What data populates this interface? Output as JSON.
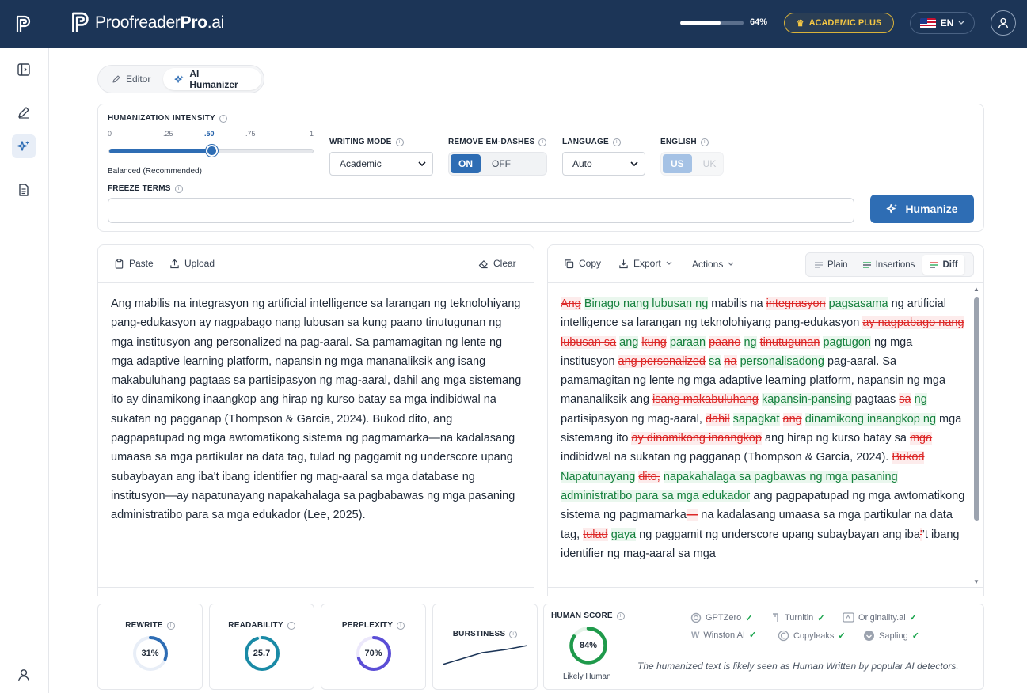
{
  "header": {
    "brand_name_light": "Proofreader",
    "brand_name_bold": "Pro",
    "brand_suffix": ".ai",
    "usage_percent_label": "64%",
    "usage_fraction": 0.64,
    "plan_label": "ACADEMIC PLUS",
    "language_label": "EN"
  },
  "mode_tabs": [
    {
      "label": "Editor"
    },
    {
      "label": "AI Humanizer"
    }
  ],
  "settings": {
    "intensity": {
      "label": "HUMANIZATION INTENSITY",
      "ticks": [
        "0",
        ".25",
        ".50",
        ".75",
        "1"
      ],
      "value": 0.5,
      "caption": "Balanced (Recommended)"
    },
    "writing_mode": {
      "label": "WRITING MODE",
      "value": "Academic"
    },
    "em_dashes": {
      "label": "REMOVE EM-DASHES",
      "on": "ON",
      "off": "OFF"
    },
    "language": {
      "label": "LANGUAGE",
      "value": "Auto"
    },
    "english": {
      "label": "ENGLISH",
      "us": "US",
      "uk": "UK"
    },
    "freeze_terms": {
      "label": "FREEZE TERMS",
      "value": ""
    },
    "humanize_label": "Humanize"
  },
  "input_pane": {
    "paste_label": "Paste",
    "upload_label": "Upload",
    "clear_label": "Clear",
    "text": "Ang mabilis na integrasyon ng artificial intelligence sa larangan ng teknolohiyang pang-edukasyon ay nagpabago nang lubusan sa kung paano tinutugunan ng mga institusyon ang personalized na pag-aaral. Sa pamamagitan ng lente ng mga adaptive learning platform, napansin ng mga mananaliksik ang isang makabuluhang pagtaas sa partisipasyon ng mag-aaral, dahil ang mga sistemang ito ay dinamikong inaangkop ang hirap ng kurso batay sa mga indibidwal na sukatan ng pagganap (Thompson & Garcia, 2024). Bukod dito, ang pagpapatupad ng mga awtomatikong sistema ng pagmamarka—na kadalasang umaasa sa mga partikular na data tag, tulad ng paggamit ng underscore upang subaybayan ang iba't ibang identifier ng mag-aaral sa mga database ng institusyon—ay napatunayang napakahalaga sa pagbabawas ng mga pasaning administratibo para sa mga edukador (Lee, 2025)."
  },
  "output_pane": {
    "copy_label": "Copy",
    "export_label": "Export",
    "actions_label": "Actions",
    "views": [
      {
        "label": "Plain"
      },
      {
        "label": "Insertions"
      },
      {
        "label": "Diff"
      }
    ],
    "segments": [
      {
        "t": "del",
        "s": "Ang"
      },
      {
        "t": "txt",
        "s": " "
      },
      {
        "t": "ins",
        "s": "Binago nang lubusan ng"
      },
      {
        "t": "txt",
        "s": " mabilis na "
      },
      {
        "t": "del",
        "s": "integrasyon"
      },
      {
        "t": "txt",
        "s": " "
      },
      {
        "t": "ins",
        "s": "pagsasama"
      },
      {
        "t": "txt",
        "s": " ng artificial intelligence sa larangan ng teknolohiyang pang-edukasyon "
      },
      {
        "t": "del",
        "s": "ay nagpabago nang lubusan sa"
      },
      {
        "t": "txt",
        "s": " "
      },
      {
        "t": "ins",
        "s": "ang"
      },
      {
        "t": "txt",
        "s": " "
      },
      {
        "t": "del",
        "s": "kung"
      },
      {
        "t": "txt",
        "s": " "
      },
      {
        "t": "ins",
        "s": "paraan"
      },
      {
        "t": "txt",
        "s": " "
      },
      {
        "t": "del",
        "s": "paano"
      },
      {
        "t": "txt",
        "s": " "
      },
      {
        "t": "ins",
        "s": "ng"
      },
      {
        "t": "txt",
        "s": " "
      },
      {
        "t": "del",
        "s": "tinutugunan"
      },
      {
        "t": "txt",
        "s": " "
      },
      {
        "t": "ins",
        "s": "pagtugon"
      },
      {
        "t": "txt",
        "s": " ng mga institusyon "
      },
      {
        "t": "del",
        "s": "ang personalized"
      },
      {
        "t": "txt",
        "s": " "
      },
      {
        "t": "ins",
        "s": "sa"
      },
      {
        "t": "txt",
        "s": " "
      },
      {
        "t": "del",
        "s": "na"
      },
      {
        "t": "txt",
        "s": " "
      },
      {
        "t": "ins",
        "s": "personalisadong"
      },
      {
        "t": "txt",
        "s": " pag-aaral. Sa pamamagitan ng lente ng mga adaptive learning platform, napansin ng mga mananaliksik ang "
      },
      {
        "t": "del",
        "s": "isang makabuluhang"
      },
      {
        "t": "txt",
        "s": " "
      },
      {
        "t": "ins",
        "s": "kapansin-pansing"
      },
      {
        "t": "txt",
        "s": " pagtaas "
      },
      {
        "t": "del",
        "s": "sa"
      },
      {
        "t": "txt",
        "s": " "
      },
      {
        "t": "ins",
        "s": "ng"
      },
      {
        "t": "txt",
        "s": " partisipasyon ng mag-aaral, "
      },
      {
        "t": "del",
        "s": "dahil"
      },
      {
        "t": "txt",
        "s": " "
      },
      {
        "t": "ins",
        "s": "sapagkat"
      },
      {
        "t": "txt",
        "s": " "
      },
      {
        "t": "del",
        "s": "ang"
      },
      {
        "t": "txt",
        "s": " "
      },
      {
        "t": "ins",
        "s": "dinamikong inaangkop ng"
      },
      {
        "t": "txt",
        "s": " mga sistemang ito "
      },
      {
        "t": "del",
        "s": "ay dinamikong inaangkop"
      },
      {
        "t": "txt",
        "s": " ang hirap ng kurso batay sa "
      },
      {
        "t": "del",
        "s": "mga"
      },
      {
        "t": "txt",
        "s": " indibidwal na sukatan ng pagganap (Thompson & Garcia, 2024). "
      },
      {
        "t": "del",
        "s": "Bukod"
      },
      {
        "t": "txt",
        "s": " "
      },
      {
        "t": "ins",
        "s": "Napatunayang"
      },
      {
        "t": "txt",
        "s": " "
      },
      {
        "t": "del",
        "s": "dito,"
      },
      {
        "t": "txt",
        "s": " "
      },
      {
        "t": "ins",
        "s": "napakahalaga sa pagbawas ng mga pasaning administratibo para sa mga edukador"
      },
      {
        "t": "txt",
        "s": " ang pagpapatupad ng mga awtomatikong sistema ng pagmamarka"
      },
      {
        "t": "del",
        "s": "—"
      },
      {
        "t": "txt",
        "s": " na kadalasang umaasa sa mga partikular na data tag, "
      },
      {
        "t": "del",
        "s": "tulad"
      },
      {
        "t": "txt",
        "s": " "
      },
      {
        "t": "ins",
        "s": "gaya"
      },
      {
        "t": "txt",
        "s": " ng paggamit ng underscore upang subaybayan ang iba"
      },
      {
        "t": "del",
        "s": "'"
      },
      {
        "t": "txt",
        "s": "’t ibang identifier ng mag-aaral sa mga"
      }
    ]
  },
  "stats": {
    "rewrite": {
      "label": "REWRITE",
      "value": "31%",
      "fraction": 0.31
    },
    "readability": {
      "label": "READABILITY",
      "value": "25.7",
      "fraction": 0.95
    },
    "perplexity": {
      "label": "PERPLEXITY",
      "value": "70%",
      "fraction": 0.7
    },
    "burstiness": {
      "label": "BURSTINESS"
    },
    "human_score": {
      "label": "HUMAN SCORE",
      "value": "84%",
      "fraction": 0.84,
      "caption": "Likely Human"
    }
  },
  "detectors": [
    {
      "name": "GPTZero"
    },
    {
      "name": "Turnitin"
    },
    {
      "name": "Originality.ai"
    },
    {
      "name": "Winston AI"
    },
    {
      "name": "Copyleaks"
    },
    {
      "name": "Sapling"
    }
  ],
  "detector_note": "The humanized text is likely seen as Human Written by popular AI detectors.",
  "colors": {
    "navy": "#1c3557",
    "accent": "#2e6db4",
    "gold": "#f4c744",
    "insert": "#15803d",
    "delete": "#dc2626"
  }
}
